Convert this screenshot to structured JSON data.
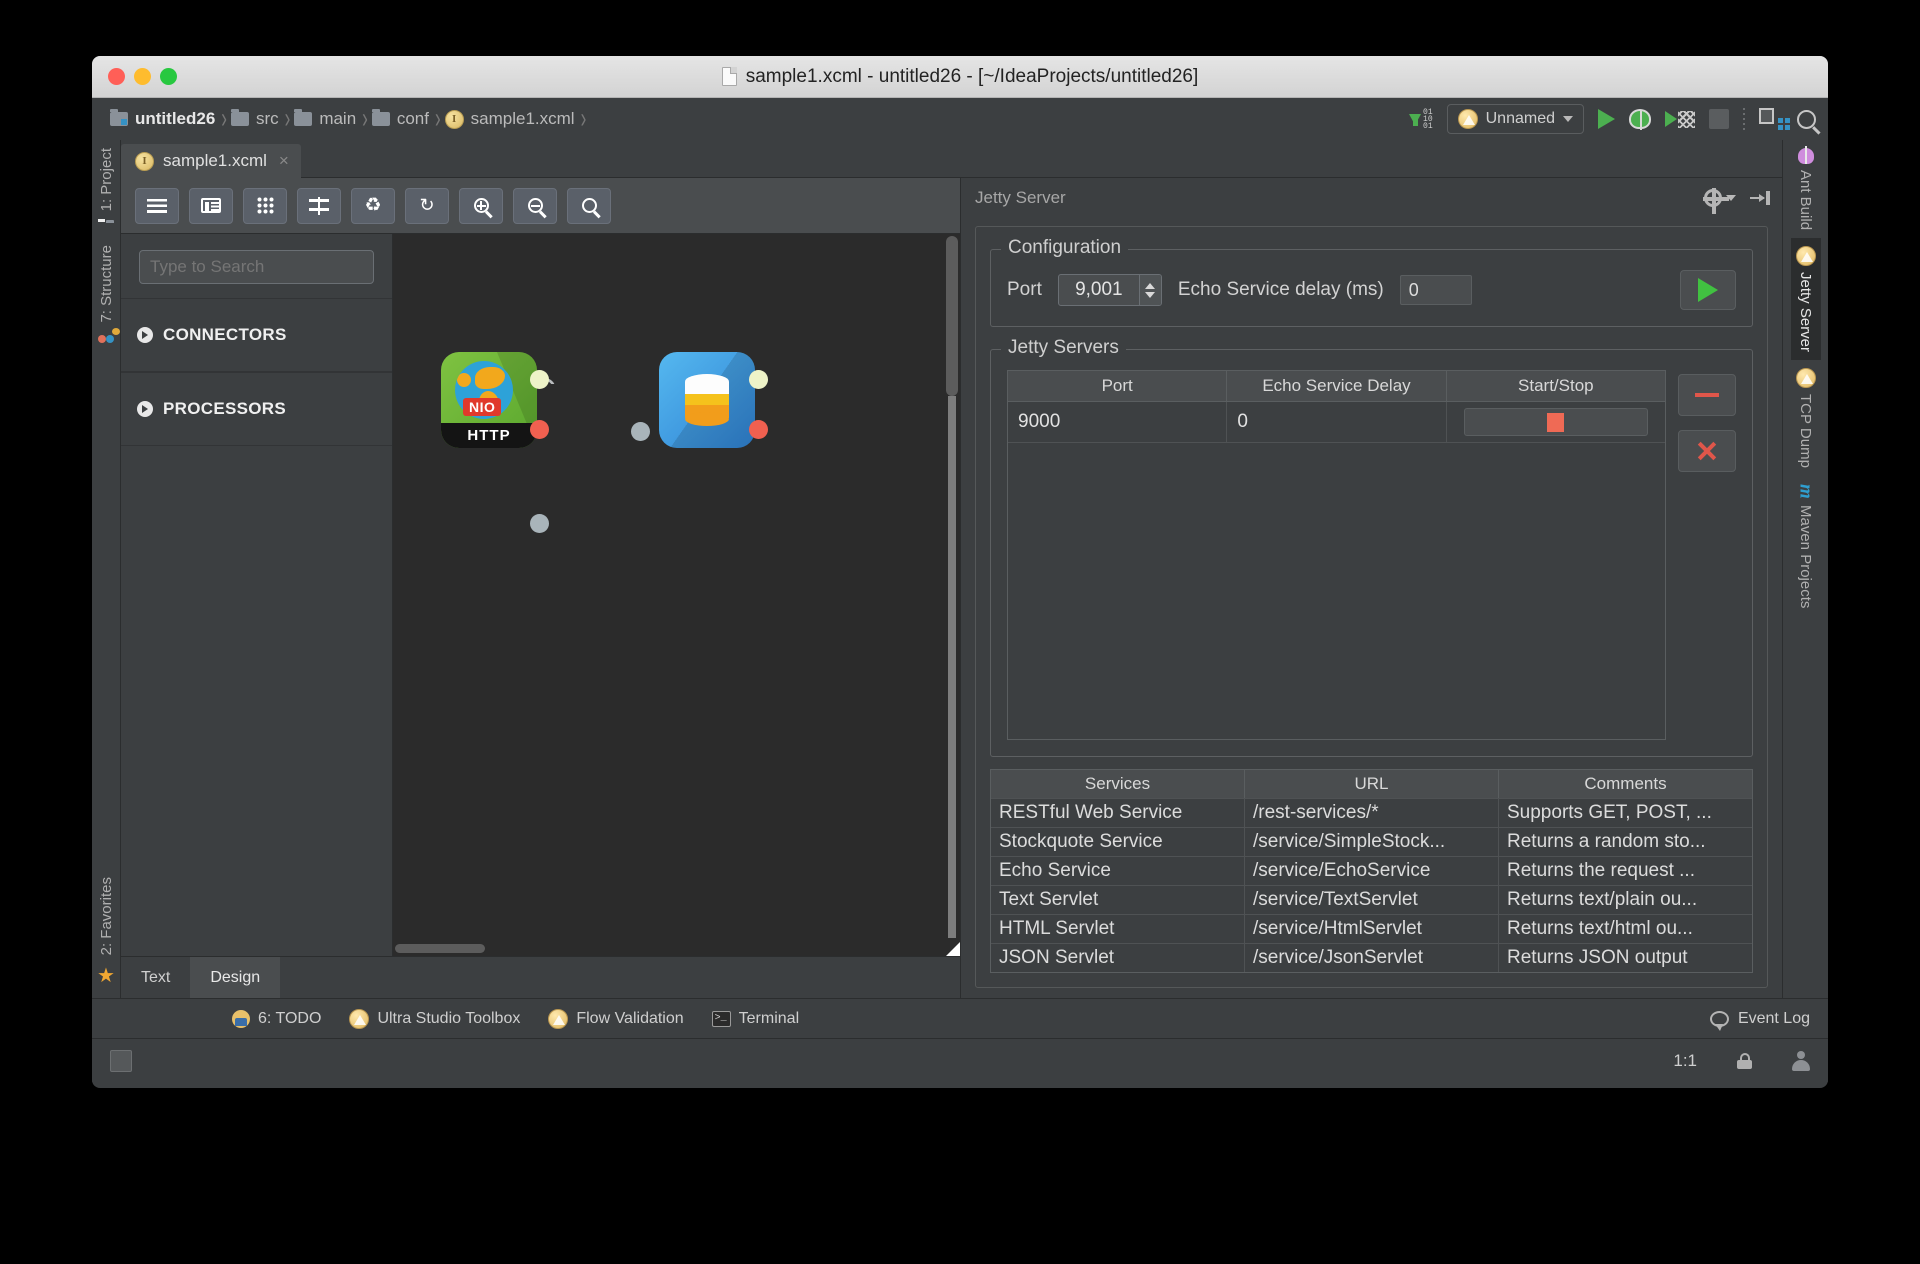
{
  "window": {
    "title": "sample1.xcml - untitled26 - [~/IdeaProjects/untitled26]"
  },
  "breadcrumb": {
    "items": [
      {
        "label": "untitled26",
        "icon": "project-folder-icon"
      },
      {
        "label": "src",
        "icon": "folder-icon"
      },
      {
        "label": "main",
        "icon": "folder-icon"
      },
      {
        "label": "conf",
        "icon": "folder-icon"
      },
      {
        "label": "sample1.xcml",
        "icon": "xcml-file-icon"
      }
    ],
    "separator": "›"
  },
  "navbar_right": {
    "run_config": "Unnamed",
    "icons": [
      "download-binary-icon",
      "run-icon",
      "debug-icon",
      "coverage-icon",
      "stop-icon",
      "layout-icon",
      "search-everywhere-icon"
    ]
  },
  "left_strip": {
    "items": [
      {
        "label": "1: Project",
        "underline": "1"
      },
      {
        "label": "7: Structure",
        "underline": "7"
      },
      {
        "label": "2: Favorites",
        "underline": "2"
      }
    ]
  },
  "right_strip": {
    "items": [
      {
        "label": "Ant Build",
        "icon": "ant-icon",
        "active": false
      },
      {
        "label": "Jetty Server",
        "icon": "ultra-studio-icon",
        "active": true
      },
      {
        "label": "TCP Dump",
        "icon": "ultra-studio-icon",
        "active": false
      },
      {
        "label": "Maven Projects",
        "icon": "maven-icon",
        "active": false
      }
    ]
  },
  "editor": {
    "tab": {
      "label": "sample1.xcml",
      "close": "×"
    },
    "toolbar_icons": [
      "menu-icon",
      "list-view-icon",
      "grid-view-icon",
      "align-icon",
      "recycle-icon",
      "refresh-icon",
      "zoom-in-icon",
      "zoom-out-icon",
      "zoom-fit-icon"
    ],
    "bottom_tabs": [
      {
        "label": "Text",
        "active": false
      },
      {
        "label": "Design",
        "active": true
      }
    ]
  },
  "palette": {
    "search_placeholder": "Type to Search",
    "search_value": "",
    "sections": [
      {
        "label": "CONNECTORS"
      },
      {
        "label": "PROCESSORS"
      }
    ]
  },
  "canvas": {
    "nodes": [
      {
        "name": "http-nio-node",
        "label": "HTTP",
        "badge": "NIO"
      },
      {
        "name": "database-node",
        "label": ""
      }
    ]
  },
  "jetty": {
    "panel_title": "Jetty Server",
    "configuration": {
      "group_title": "Configuration",
      "port_label": "Port",
      "port_value": "9,001",
      "delay_label": "Echo Service delay (ms)",
      "delay_value": "0",
      "start_button": "start-server-button"
    },
    "servers": {
      "group_title": "Jetty Servers",
      "columns": [
        "Port",
        "Echo Service Delay",
        "Start/Stop"
      ],
      "rows": [
        {
          "port": "9000",
          "delay": "0",
          "state": "running"
        }
      ],
      "buttons": [
        "remove-server-button",
        "delete-server-button"
      ]
    },
    "services": {
      "columns": [
        "Services",
        "URL",
        "Comments"
      ],
      "rows": [
        {
          "service": "RESTful Web Service",
          "url": "/rest-services/*",
          "comment": "Supports GET, POST, ..."
        },
        {
          "service": "Stockquote Service",
          "url": "/service/SimpleStock...",
          "comment": "Returns a random sto..."
        },
        {
          "service": "Echo Service",
          "url": "/service/EchoService",
          "comment": "Returns the request ..."
        },
        {
          "service": "Text Servlet",
          "url": "/service/TextServlet",
          "comment": "Returns text/plain ou..."
        },
        {
          "service": "HTML Servlet",
          "url": "/service/HtmlServlet",
          "comment": "Returns text/html ou..."
        },
        {
          "service": "JSON Servlet",
          "url": "/service/JsonServlet",
          "comment": "Returns JSON output"
        }
      ]
    }
  },
  "toolwindow_bar": {
    "items": [
      {
        "label": "6: TODO",
        "underline": "6",
        "icon": "todo-icon"
      },
      {
        "label": "Ultra Studio Toolbox",
        "icon": "ultra-studio-icon"
      },
      {
        "label": "Flow Validation",
        "icon": "ultra-studio-icon"
      },
      {
        "label": "Terminal",
        "icon": "terminal-icon"
      }
    ],
    "event_log": "Event Log"
  },
  "statusbar": {
    "caret_position": "1:1"
  }
}
